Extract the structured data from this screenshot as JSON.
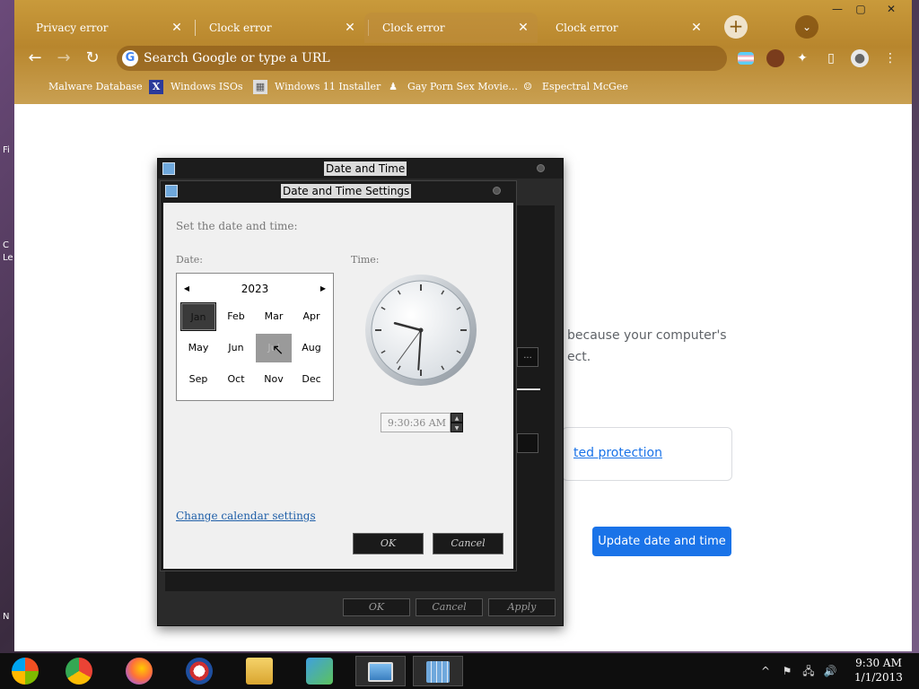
{
  "browser": {
    "tabs": [
      {
        "title": "Privacy error",
        "close": "✕"
      },
      {
        "title": "Clock error",
        "close": "✕"
      },
      {
        "title": "Clock error",
        "close": "✕"
      },
      {
        "title": "Clock error",
        "close": "✕"
      }
    ],
    "new_tab_icon": "+",
    "tab_search_icon": "⌄",
    "window_controls": {
      "minimize": "—",
      "maximize": "▢",
      "close": "✕"
    },
    "nav": {
      "back": "←",
      "forward": "→",
      "reload": "↻"
    },
    "omnibox": {
      "google_icon": "G",
      "placeholder": "Search Google or type a URL"
    },
    "toolbar_icons": {
      "extensions": "✦",
      "sidepanel": "▯",
      "profile": "●",
      "menu": "⋮"
    },
    "bookmarks": [
      {
        "label": "Malware Database",
        "icon": ""
      },
      {
        "label": "Windows ISOs",
        "icon": "X"
      },
      {
        "label": "Windows 11 Installer",
        "icon": "▦"
      },
      {
        "label": "Gay Porn Sex Movie...",
        "icon": "♟"
      },
      {
        "label": "Espectral McGee",
        "icon": "☺"
      }
    ],
    "error_page": {
      "line1": "because your computer's",
      "line2": "ect.",
      "protection_link": "ted protection",
      "update_button": "Update date and time"
    }
  },
  "date_time_window": {
    "title": "Date and Time",
    "buttons": {
      "ok": "OK",
      "cancel": "Cancel",
      "apply": "Apply"
    },
    "partial_button": "..."
  },
  "date_time_settings": {
    "title": "Date and Time Settings",
    "instruction": "Set the date and time:",
    "date_label": "Date:",
    "time_label": "Time:",
    "calendar": {
      "year": "2023",
      "prev": "◀",
      "next": "▶",
      "months": [
        "Jan",
        "Feb",
        "Mar",
        "Apr",
        "May",
        "Jun",
        "Jul",
        "Aug",
        "Sep",
        "Oct",
        "Nov",
        "Dec"
      ],
      "selected": "Jan",
      "hovered": "Jul"
    },
    "time_value": "9:30:36 AM",
    "clock": {
      "hours": 9,
      "minutes": 30,
      "seconds": 36
    },
    "spin_up": "▲",
    "spin_down": "▼",
    "change_calendar_link": "Change calendar settings",
    "ok": "OK",
    "cancel": "Cancel"
  },
  "taskbar": {
    "tray": {
      "chevron": "^",
      "flag": "⚑",
      "network": "🖧",
      "volume": "🔊"
    },
    "clock_time": "9:30 AM",
    "clock_date": "1/1/2013"
  },
  "edge_text": {
    "a": "Fi",
    "b": "C",
    "c": "Le",
    "d": "N"
  }
}
